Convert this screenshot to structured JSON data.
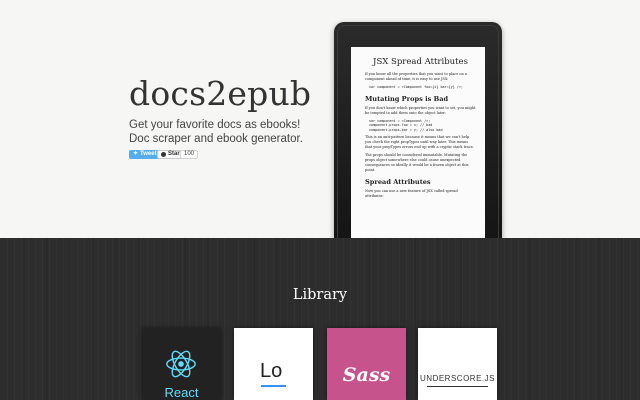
{
  "hero": {
    "title": "docs2epub",
    "tagline_line1": "Get your favorite docs as ebooks!",
    "tagline_line2": "Doc scraper and ebook generator.",
    "tweet_label": "Tweet",
    "star_label": "Star",
    "star_count": "100"
  },
  "kindle_screen": {
    "heading": "JSX Spread Attributes",
    "intro": "If you know all the properties that you want to place on a component ahead of time, it is easy to use JSX:",
    "code1": "var component = <Component foo={x} bar={y} />;",
    "section1_heading": "Mutating Props is Bad",
    "para1": "If you don't know which properties you want to set, you might be tempted to add them onto the object later:",
    "code2": "var component = <Component />;\ncomponent.props.foo = x; // bad\ncomponent.props.bar = y; // also bad",
    "para2": "This is an anti-pattern because it means that we can't help you check the right propTypes until way later. This means that your propTypes errors end up with a cryptic stack trace.",
    "para3": "The props should be considered immutable. Mutating the props object somewhere else could cause unexpected consequences so ideally it would be a frozen object at this point.",
    "section2_heading": "Spread Attributes",
    "para4": "Now you can use a new feature of JSX called spread attributes:"
  },
  "library": {
    "title": "Library",
    "books": {
      "react": {
        "label": "React",
        "color": "#61dafb"
      },
      "lodash": {
        "label": "Lo",
        "color": "#3492ff"
      },
      "sass": {
        "label": "Sass",
        "color": "#c6538c"
      },
      "underscore": {
        "label": "UNDERSCORE.JS"
      }
    }
  },
  "colors": {
    "tweet": "#55acee",
    "library_bg": "#2e2d2d"
  }
}
